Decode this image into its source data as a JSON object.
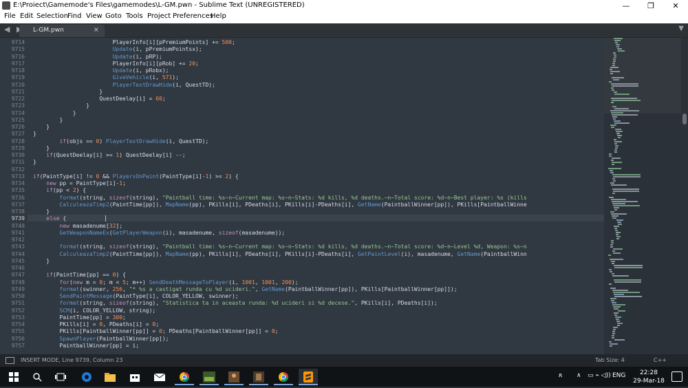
{
  "window": {
    "title": "E:\\Proiect\\Gamemode's Files\\gamemodes\\L-GM.pwn - Sublime Text (UNREGISTERED)",
    "minimize": "—",
    "maximize": "❐",
    "close": "✕"
  },
  "menu": [
    "File",
    "Edit",
    "Selection",
    "Find",
    "View",
    "Goto",
    "Tools",
    "Project",
    "Preferences",
    "Help"
  ],
  "tab": {
    "name": "L-GM.pwn",
    "close": "×"
  },
  "nav_arrows": "◀ ▶",
  "dropdown": "▼",
  "editor": {
    "active_line": "9739",
    "lines": [
      {
        "n": "9714",
        "t": "                        PlayerInfo[i][pPremiumPoints] += 500;"
      },
      {
        "n": "9715",
        "t": "                        Update(i, pPremiumPointsx);"
      },
      {
        "n": "9716",
        "t": "                        Update(i, pRP);"
      },
      {
        "n": "9717",
        "t": "                        PlayerInfo[i][pRob] += 20;"
      },
      {
        "n": "9718",
        "t": "                        Update(i, pRobx);"
      },
      {
        "n": "9719",
        "t": "                        GiveVehicle(i, 571);"
      },
      {
        "n": "9720",
        "t": "                        PlayerTextDrawHide(i, QuestTD);"
      },
      {
        "n": "9721",
        "t": "                    }"
      },
      {
        "n": "9722",
        "t": "                    QuestDeelay[i] = 60;"
      },
      {
        "n": "9723",
        "t": "                }"
      },
      {
        "n": "9724",
        "t": "            }"
      },
      {
        "n": "9725",
        "t": "        }"
      },
      {
        "n": "9726",
        "t": "    }"
      },
      {
        "n": "9727",
        "t": "}"
      },
      {
        "n": "9728",
        "t": "        if(objs == 0) PlayerTextDrawHide(i, QuestTD);"
      },
      {
        "n": "9729",
        "t": "    }"
      },
      {
        "n": "9730",
        "t": "    if(QuestDeelay[i] >= 1) QuestDeelay[i] --;"
      },
      {
        "n": "9731",
        "t": "}"
      },
      {
        "n": "9732",
        "t": ""
      },
      {
        "n": "9733",
        "t": "if(PaintType[i] != 0 && PlayersOnPaint(PaintType[i]-1) >= 2) {"
      },
      {
        "n": "9734",
        "t": "    new pp = PaintType[i]-1;"
      },
      {
        "n": "9735",
        "t": "    if(pp < 2) {"
      },
      {
        "n": "9736",
        "t": "        format(string, sizeof(string), \"Paintball time: %s~n~Current map: %s~n~Stats: %d kills, %d deaths.~n~Total score: %d~n~Best player: %s (kills"
      },
      {
        "n": "9737",
        "t": "        CalculeazaTimp2(PaintTime[pp]), MapName(pp), PKills[i], PDeaths[i], PKills[i]-PDeaths[i], GetName(PaintballWinner[pp]), PKills[PaintballWinne"
      },
      {
        "n": "9738",
        "t": "    }"
      },
      {
        "n": "9739",
        "t": "    else {"
      },
      {
        "n": "9740",
        "t": "        new masadenume[32];"
      },
      {
        "n": "9741",
        "t": "        GetWeaponNameEx(GetPlayerWeapon(i), masadenume, sizeof(masadenume));"
      },
      {
        "n": "9742",
        "t": ""
      },
      {
        "n": "9743",
        "t": "        format(string, sizeof(string), \"Paintball time: %s~n~Current map: %s~n~Stats: %d kills, %d deaths.~n~Total score: %d~n~Level %d, Weapon: %s~n"
      },
      {
        "n": "9744",
        "t": "        CalculeazaTimp2(PaintTime[pp]), MapName(pp), PKills[i], PDeaths[i], PKills[i]-PDeaths[i], GetPaintLevel(i), masadenume, GetName(PaintballWinn"
      },
      {
        "n": "9745",
        "t": "    }"
      },
      {
        "n": "9746",
        "t": ""
      },
      {
        "n": "9747",
        "t": "    if(PaintTime[pp] == 0) {"
      },
      {
        "n": "9748",
        "t": "        for(new m = 0; m < 5; m++) SendDeathMessageToPlayer(i, 1001, 1001, 200);"
      },
      {
        "n": "9749",
        "t": "        format(swinner, 256, \"* %s a castigat runda cu %d ucideri.\", GetName(PaintballWinner[pp]), PKills[PaintballWinner[pp]]);"
      },
      {
        "n": "9750",
        "t": "        SendPaintMessage(PaintType[i], COLOR_YELLOW, swinner);"
      },
      {
        "n": "9751",
        "t": "        format(string, sizeof(string), \"Statistica ta in aceasta runda: %d ucideri si %d decese.\", PKills[i], PDeaths[i]);"
      },
      {
        "n": "9752",
        "t": "        SCM(i, COLOR_YELLOW, string);"
      },
      {
        "n": "9753",
        "t": "        PaintTime[pp] = 300;"
      },
      {
        "n": "9754",
        "t": "        PKills[i] = 0, PDeaths[i] = 0;"
      },
      {
        "n": "9755",
        "t": "        PKills[PaintballWinner[pp]] = 0; PDeaths[PaintballWinner[pp]] = 0;"
      },
      {
        "n": "9756",
        "t": "        SpawnPlayer(PaintballWinner[pp]);"
      },
      {
        "n": "9757",
        "t": "        PaintballWinner[pp] = i;"
      }
    ]
  },
  "status": {
    "mode": "INSERT MODE, Line 9739, Column 23",
    "tab_size": "Tab Size: 4",
    "syntax": "C++"
  },
  "taskbar": {
    "tray_lang": "ENG",
    "time": "22:28",
    "date": "29-Mar-18",
    "person_icon": "ጸ",
    "chevron": "∧",
    "tray_icons": "▭ ⌁ ◁))"
  },
  "colors": {
    "editor_bg": "#303841",
    "gutter_text": "#7e8690",
    "code_text": "#d8dee9",
    "keyword": "#c594c5",
    "function": "#6699cc",
    "string": "#99c794",
    "number": "#f99157",
    "cursor": "#f9ae58"
  }
}
